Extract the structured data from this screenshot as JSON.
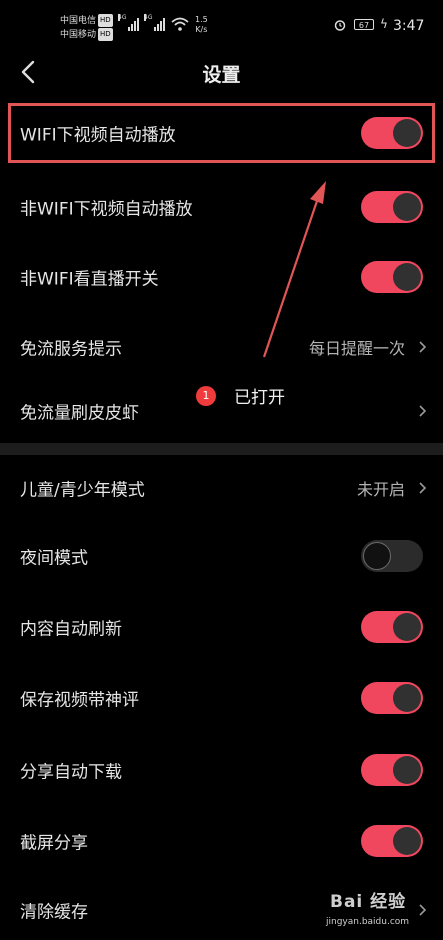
{
  "status_bar": {
    "carrier1": "中国电信",
    "carrier2": "中国移动",
    "hd": "HD",
    "net1": "4G",
    "net2": "4G",
    "speed_value": "1.5",
    "speed_unit": "K/s",
    "battery": "67",
    "time": "3:47"
  },
  "header": {
    "title": "设置"
  },
  "settings": {
    "wifi_autoplay": {
      "label": "WIFI下视频自动播放",
      "on": true
    },
    "non_wifi_autoplay": {
      "label": "非WIFI下视频自动播放",
      "on": true
    },
    "non_wifi_live": {
      "label": "非WIFI看直播开关",
      "on": true
    },
    "data_free_tip": {
      "label": "免流服务提示",
      "value": "每日提醒一次"
    },
    "data_free_shrimp": {
      "label": "免流量刷皮皮虾"
    },
    "teen_mode": {
      "label": "儿童/青少年模式",
      "value": "未开启"
    },
    "night_mode": {
      "label": "夜间模式",
      "on": false
    },
    "auto_refresh": {
      "label": "内容自动刷新",
      "on": true
    },
    "save_with_comments": {
      "label": "保存视频带神评",
      "on": true
    },
    "auto_download_share": {
      "label": "分享自动下载",
      "on": true
    },
    "screenshot_share": {
      "label": "截屏分享",
      "on": true
    },
    "clear_cache": {
      "label": "清除缓存"
    }
  },
  "annotation": {
    "step_number": "1",
    "text": "已打开",
    "color": "#e05555"
  },
  "watermark": {
    "logo": "Bai 经验",
    "url": "jingyan.baidu.com"
  },
  "colors": {
    "toggle_on": "#f0475e",
    "background": "#000000"
  }
}
